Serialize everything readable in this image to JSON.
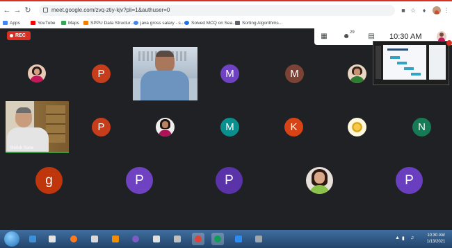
{
  "browser": {
    "url": "meet.google.com/zvq-ztiy-kjv?pli=1&authuser=0",
    "bookmarks": [
      {
        "label": "Apps",
        "color": "#4285f4"
      },
      {
        "label": "YouTube",
        "color": "#ff0000"
      },
      {
        "label": "Maps",
        "color": "#34a853"
      },
      {
        "label": "SPPU Data Structur...",
        "color": "#f57c00"
      },
      {
        "label": "java gross salary - s...",
        "color": "#4285f4"
      },
      {
        "label": "Solved MCQ on Sea...",
        "color": "#1a73e8"
      },
      {
        "label": "Sorting Algorithms...",
        "color": "#5f6368"
      }
    ]
  },
  "meet": {
    "rec_label": "REC",
    "time": "10:30 AM",
    "people_count": "29",
    "participants": {
      "r1_p": "P",
      "r1_m": "M",
      "r1_m2": "M",
      "r2_p": "P",
      "r2_m": "M",
      "r2_k": "K",
      "r2_n": "N",
      "r3_g": "g",
      "r3_p1": "P",
      "r3_p2": "P",
      "r3_p3": "P"
    },
    "video_name": "Shirish Sane",
    "colors": {
      "orange_red": "#c53d1a",
      "purple": "#6f42c1",
      "brown": "#7a4335",
      "teal": "#0a8f8f",
      "orange": "#d84315",
      "green": "#157a55",
      "red": "#bf360c",
      "violet": "#6a3fbf"
    }
  },
  "taskbar": {
    "clock_time": "10:30 AM",
    "clock_date": "1/13/2021"
  }
}
